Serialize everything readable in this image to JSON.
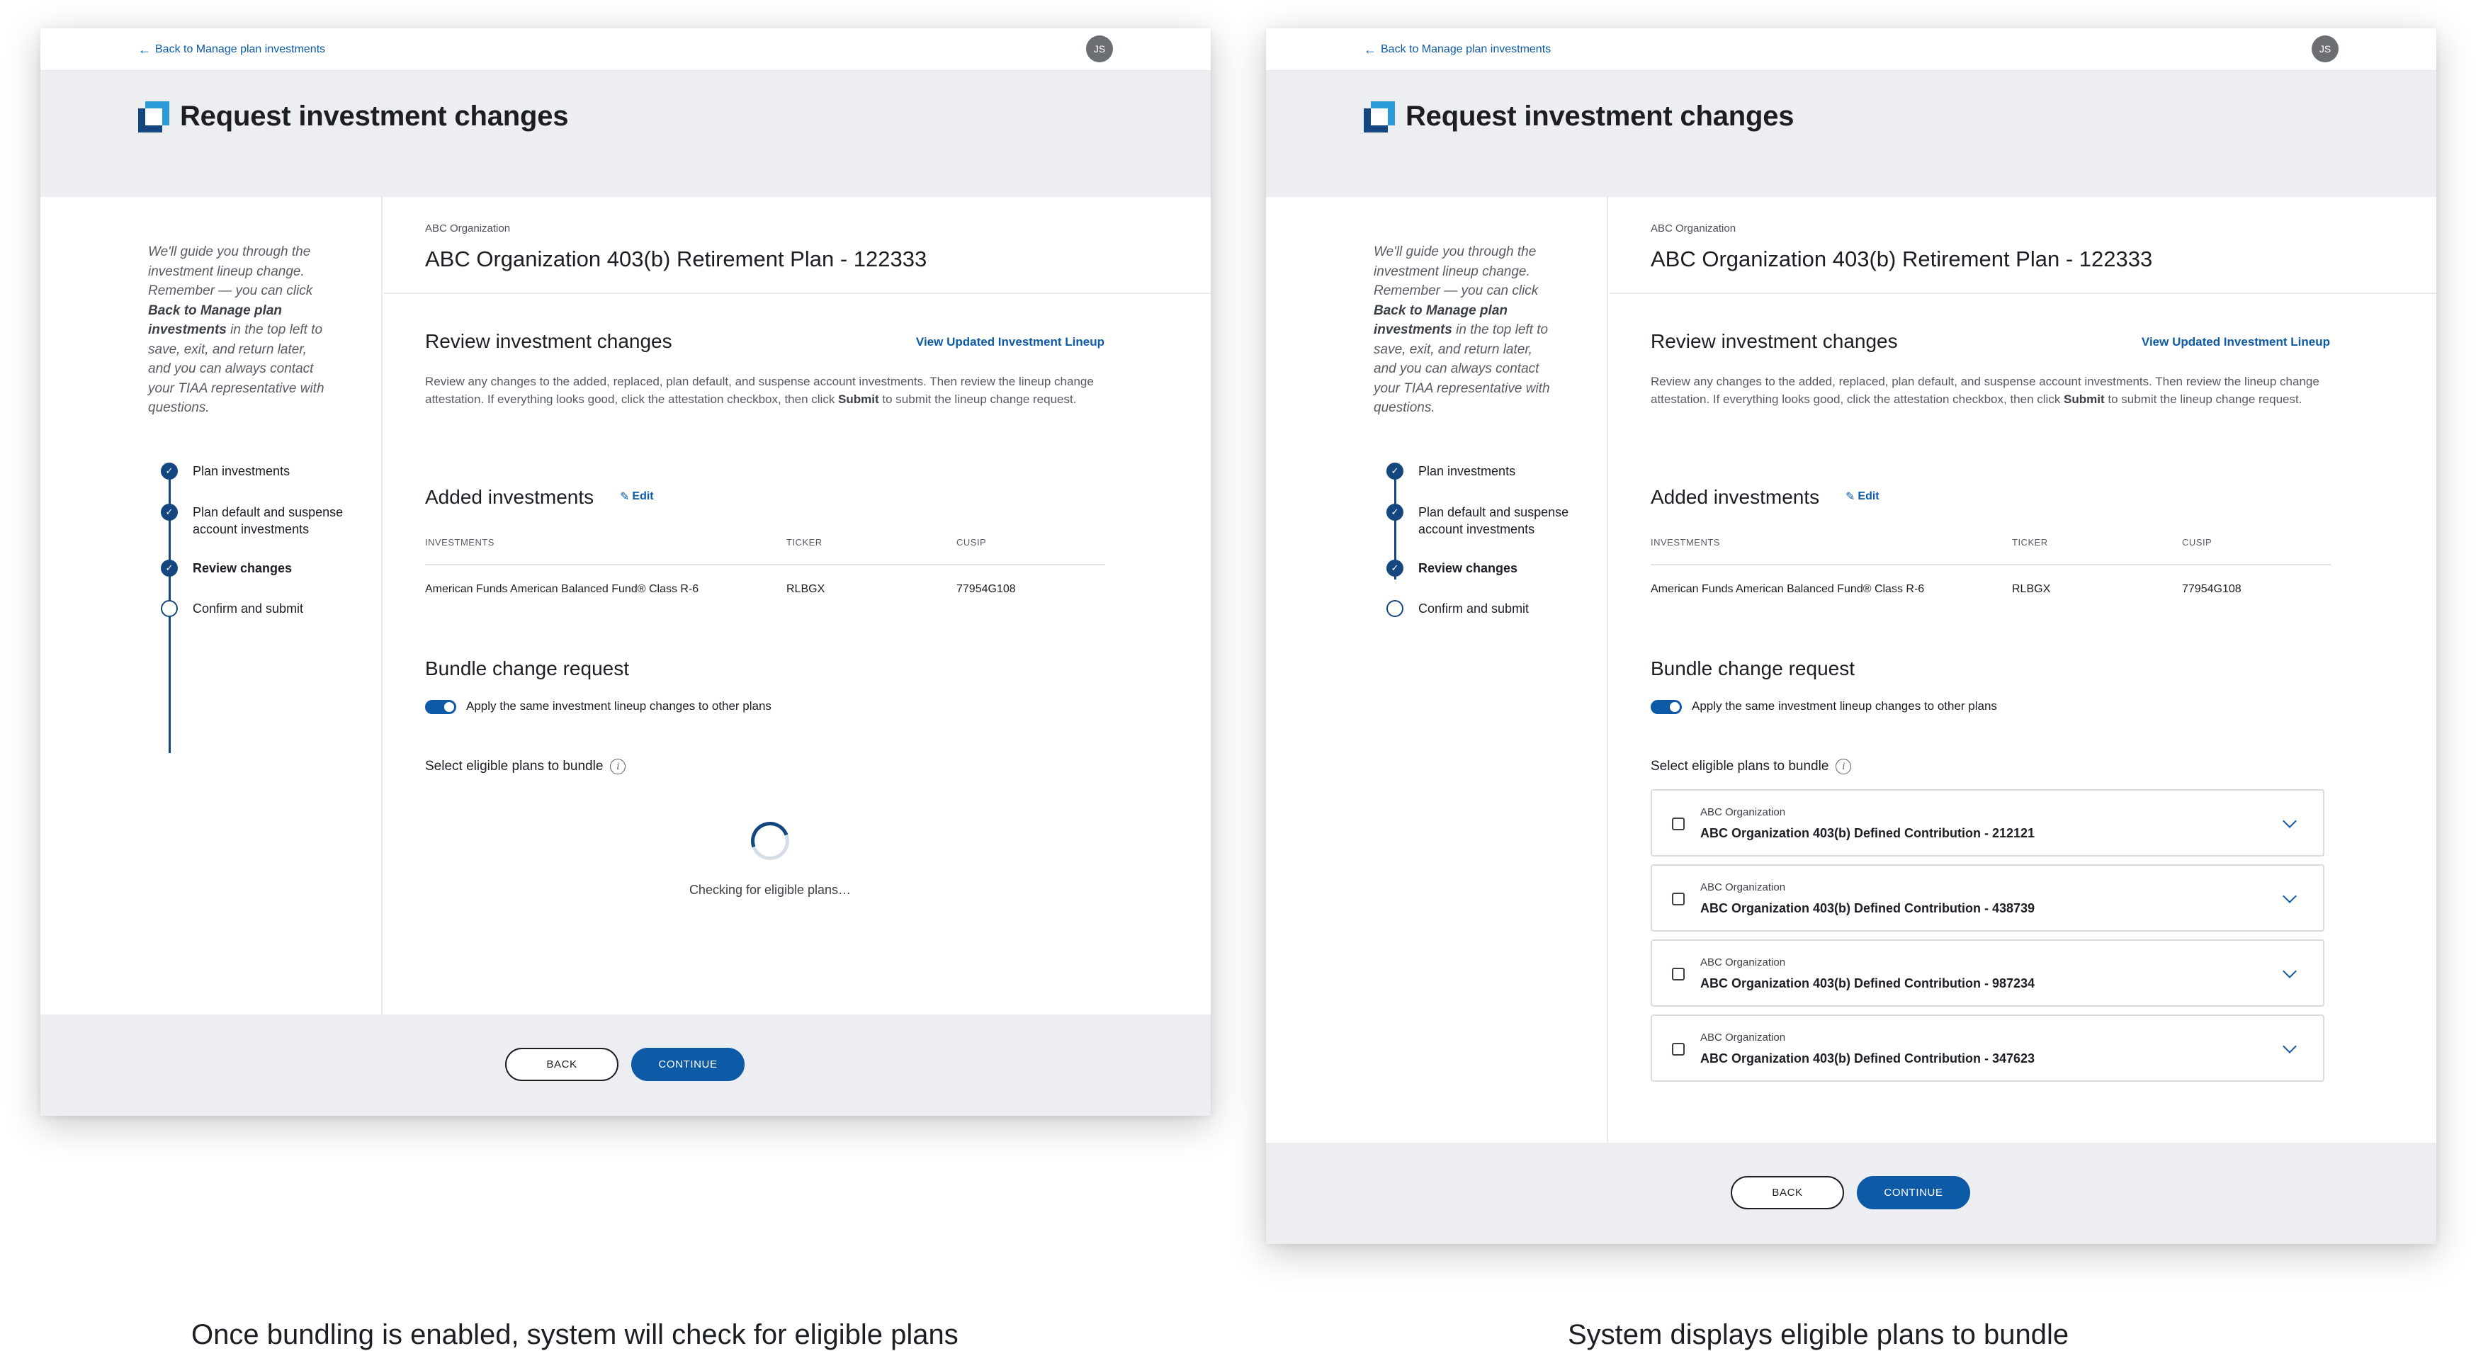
{
  "common": {
    "back_link": "Back to Manage plan investments",
    "avatar_initials": "JS",
    "page_title": "Request investment changes",
    "guide_parts": {
      "p1": "We'll guide you through the investment lineup change. Remember — you can click ",
      "bold": "Back to Manage plan investments",
      "p2": " in the top left to save, exit, and return later, and you can always contact your TIAA representative with questions."
    },
    "steps": [
      {
        "label": "Plan investments",
        "status": "complete"
      },
      {
        "label": "Plan default and suspense account investments",
        "status": "complete"
      },
      {
        "label": "Review changes",
        "status": "current"
      },
      {
        "label": "Confirm and submit",
        "status": "pending"
      }
    ],
    "org_name": "ABC Organization",
    "plan_title": "ABC Organization 403(b) Retirement Plan - 122333",
    "review_title": "Review investment changes",
    "lineup_link": "View Updated Investment Lineup",
    "review_desc": {
      "p1": "Review any changes to the added, replaced, plan default, and suspense account investments. Then review the lineup change attestation. If everything looks good, click the attestation checkbox, then click ",
      "bold": "Submit",
      "p2": " to submit the lineup change request."
    },
    "added_title": "Added investments",
    "edit_label": "Edit",
    "table": {
      "headers": [
        "INVESTMENTS",
        "TICKER",
        "CUSIP"
      ],
      "rows": [
        [
          "American Funds American Balanced Fund® Class R-6",
          "RLBGX",
          "77954G108"
        ]
      ]
    },
    "bundle_title": "Bundle change request",
    "toggle_label": "Apply the same investment lineup changes to other plans",
    "select_label": "Select eligible plans to bundle",
    "back_button": "BACK",
    "continue_button": "CONTINUE",
    "accent_color": "#0d5aa7"
  },
  "left": {
    "spinner_text": "Checking for eligible plans…",
    "caption": "Once bundling is enabled, system will check for eligible plans"
  },
  "right": {
    "eligible_plans": [
      {
        "org": "ABC Organization",
        "name": "ABC Organization 403(b) Defined Contribution - 212121"
      },
      {
        "org": "ABC Organization",
        "name": "ABC Organization 403(b) Defined Contribution - 438739"
      },
      {
        "org": "ABC Organization",
        "name": "ABC Organization 403(b) Defined Contribution - 987234"
      },
      {
        "org": "ABC Organization",
        "name": "ABC Organization 403(b) Defined Contribution - 347623"
      }
    ],
    "caption": "System displays eligible plans to bundle"
  }
}
